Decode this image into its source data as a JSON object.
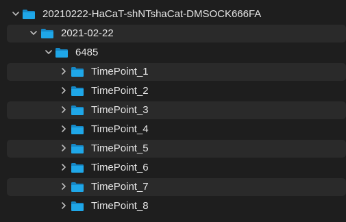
{
  "colors": {
    "background": "#1e1e1e",
    "row_stripe": "#2a2a2a",
    "text": "#e6e6e6",
    "folder_blue": "#1fa7e8",
    "folder_blue_dark": "#1688c6",
    "chevron": "#bdbdbd"
  },
  "tree": {
    "root": {
      "label": "20210222-HaCaT-shNTshaCat-DMSOCK666FA",
      "expanded": true,
      "icon": "folder-icon"
    },
    "date_folder": {
      "label": "2021-02-22",
      "expanded": true,
      "icon": "folder-icon"
    },
    "plate_folder": {
      "label": "6485",
      "expanded": true,
      "icon": "folder-icon"
    },
    "timepoints": [
      {
        "label": "TimePoint_1",
        "expanded": false,
        "icon": "folder-icon"
      },
      {
        "label": "TimePoint_2",
        "expanded": false,
        "icon": "folder-icon"
      },
      {
        "label": "TimePoint_3",
        "expanded": false,
        "icon": "folder-icon"
      },
      {
        "label": "TimePoint_4",
        "expanded": false,
        "icon": "folder-icon"
      },
      {
        "label": "TimePoint_5",
        "expanded": false,
        "icon": "folder-icon"
      },
      {
        "label": "TimePoint_6",
        "expanded": false,
        "icon": "folder-icon"
      },
      {
        "label": "TimePoint_7",
        "expanded": false,
        "icon": "folder-icon"
      },
      {
        "label": "TimePoint_8",
        "expanded": false,
        "icon": "folder-icon"
      }
    ]
  }
}
